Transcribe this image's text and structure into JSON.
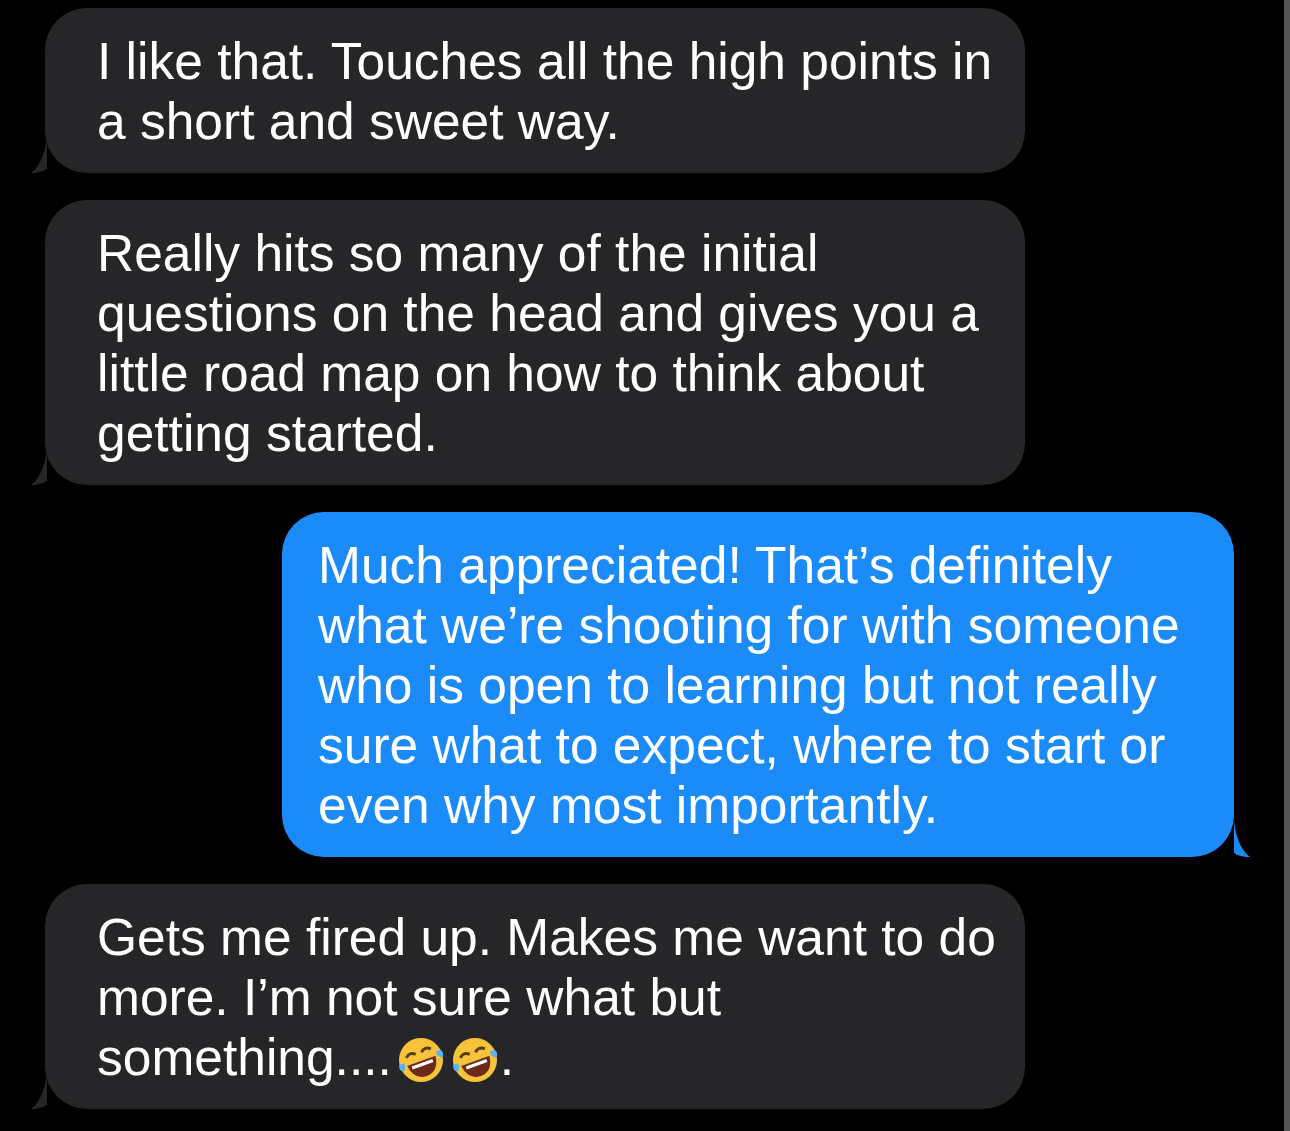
{
  "messages": [
    {
      "kind": "received",
      "parts": [
        {
          "kind": "paragraph",
          "text": "I like that. Touches all the high points in a short and sweet way."
        }
      ]
    },
    {
      "kind": "received",
      "parts": [
        {
          "kind": "paragraph",
          "text": "Really hits so many of the initial questions on the head and gives you a little road map on how to think about getting started."
        }
      ]
    },
    {
      "kind": "sent",
      "parts": [
        {
          "kind": "paragraph",
          "text": "Much appreciated! That’s definitely what we’re shooting for with someone who is open to learning but not really sure what to expect, where to start or even why most importantly."
        }
      ]
    },
    {
      "kind": "received",
      "parts": [
        {
          "kind": "paragraph",
          "text": "Gets me fired up. Makes me want to do more. I’m not sure what but"
        },
        {
          "kind": "text",
          "text": "something...."
        },
        {
          "kind": "emoji"
        },
        {
          "kind": "emoji"
        },
        {
          "kind": "text",
          "text": "."
        }
      ]
    }
  ]
}
